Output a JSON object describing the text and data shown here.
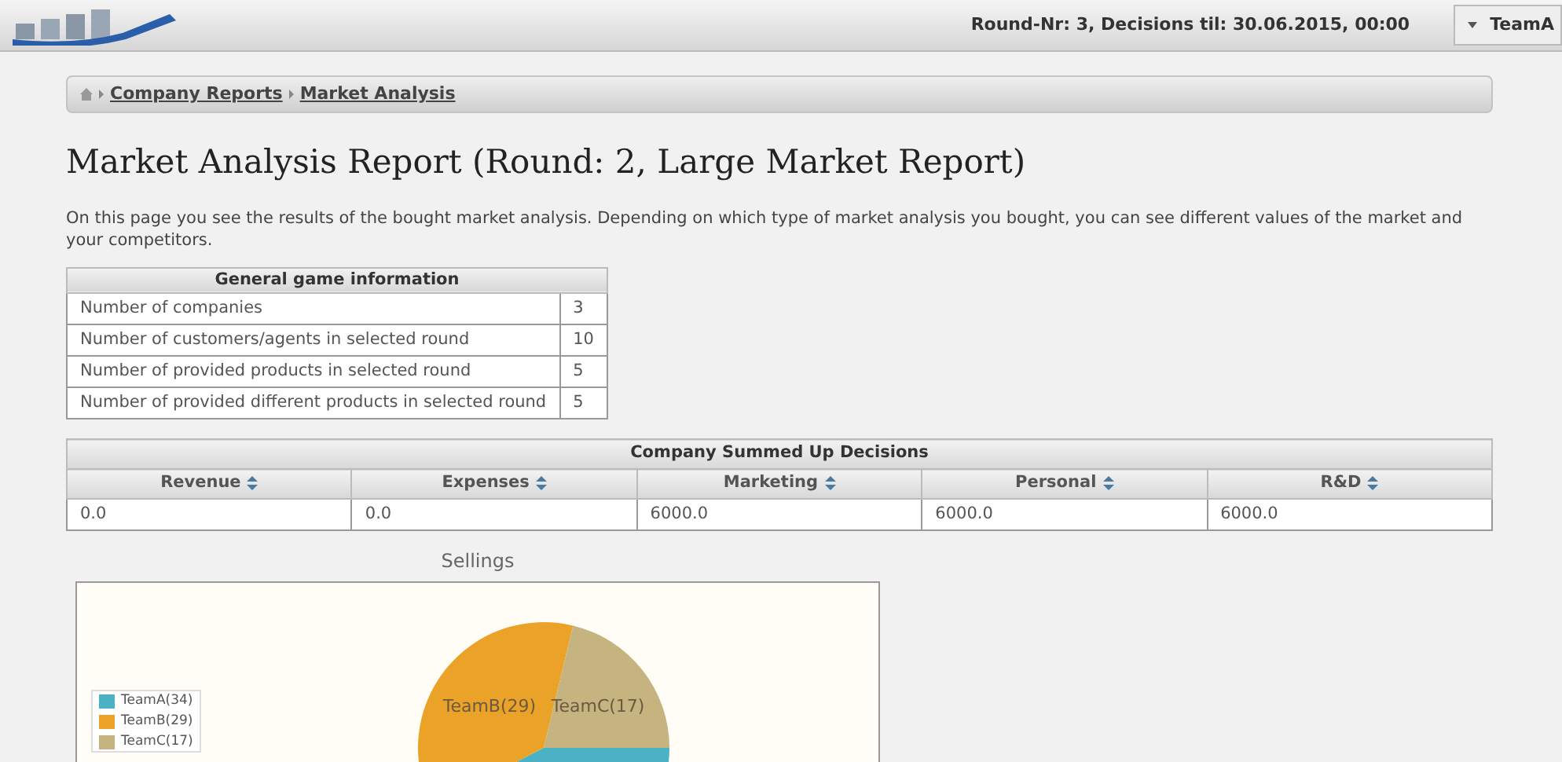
{
  "header": {
    "round_info": "Round-Nr: 3, Decisions til: 30.06.2015, 00:00",
    "team_menu": "TeamA"
  },
  "breadcrumb": [
    "Company Reports",
    "Market Analysis"
  ],
  "title": "Market Analysis Report (Round: 2, Large Market Report)",
  "intro": "On this page you see the results of the bought market analysis. Depending on which type of market analysis you bought, you can see different values of the market and your competitors.",
  "general_info": {
    "title": "General game information",
    "rows": [
      {
        "label": "Number of companies",
        "value": "3"
      },
      {
        "label": "Number of customers/agents in selected round",
        "value": "10"
      },
      {
        "label": "Number of provided products in selected round",
        "value": "5"
      },
      {
        "label": "Number of provided different products in selected round",
        "value": "5"
      }
    ]
  },
  "decisions": {
    "title": "Company Summed Up Decisions",
    "columns": [
      "Revenue",
      "Expenses",
      "Marketing",
      "Personal",
      "R&D"
    ],
    "rows": [
      [
        "0.0",
        "0.0",
        "6000.0",
        "6000.0",
        "6000.0"
      ]
    ]
  },
  "sellings": {
    "slices": [
      {
        "color": "#4bb2c5"
      },
      {
        "color": "#eaa228"
      },
      {
        "color": "#c5b47f"
      }
    ],
    "chart_data": {
      "type": "pie",
      "title": "Sellings",
      "categories": [
        "TeamA(34)",
        "TeamB(29)",
        "TeamC(17)"
      ],
      "values": [
        34,
        29,
        17
      ]
    }
  }
}
